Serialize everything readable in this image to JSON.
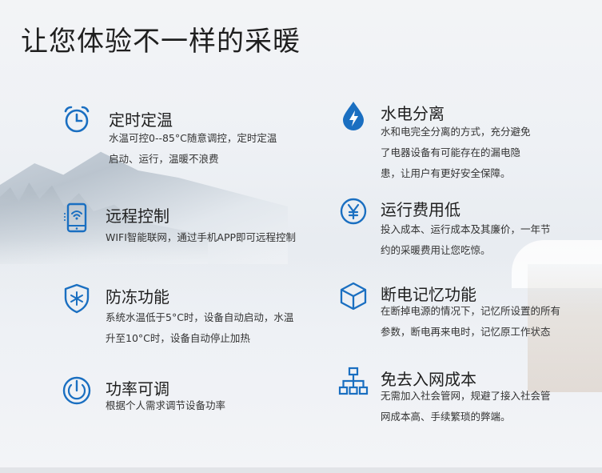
{
  "title": "让您体验不一样的采暖",
  "accent_color": "#1a6fc1",
  "features_left": [
    {
      "icon": "alarm-clock-icon",
      "title": "定时定温",
      "description_lines": [
        "水温可控0--85°C随意调控，定时定温",
        "启动、运行，温暖不浪费"
      ]
    },
    {
      "icon": "remote-phone-icon",
      "title": "远程控制",
      "description_lines": [
        "WIFI智能联网，通过手机APP即可远程控制"
      ]
    },
    {
      "icon": "snowflake-shield-icon",
      "title": "防冻功能",
      "description_lines": [
        "系统水温低于5°C时，设备自动启动，水温",
        "升至10°C时，设备自动停止加热"
      ]
    },
    {
      "icon": "power-dial-icon",
      "title": "功率可调",
      "description_lines": [
        "根据个人需求调节设备功率"
      ]
    }
  ],
  "features_right": [
    {
      "icon": "lightning-drop-icon",
      "title": "水电分离",
      "description_lines": [
        "水和电完全分离的方式，充分避免",
        "了电器设备有可能存在的漏电隐",
        "患，让用户有更好安全保障。"
      ]
    },
    {
      "icon": "yen-coin-icon",
      "title": "运行费用低",
      "description_lines": [
        "投入成本、运行成本及其廉价，一年节",
        "约的采暖费用让您吃惊。"
      ]
    },
    {
      "icon": "cube-icon",
      "title": "断电记忆功能",
      "description_lines": [
        "在断掉电源的情况下，记忆所设置的所有",
        "参数，断电再来电时，记忆原工作状态"
      ]
    },
    {
      "icon": "network-tree-icon",
      "title": "免去入网成本",
      "description_lines": [
        "无需加入社会管网，规避了接入社会管",
        "网成本高、手续繁琐的弊端。"
      ]
    }
  ]
}
